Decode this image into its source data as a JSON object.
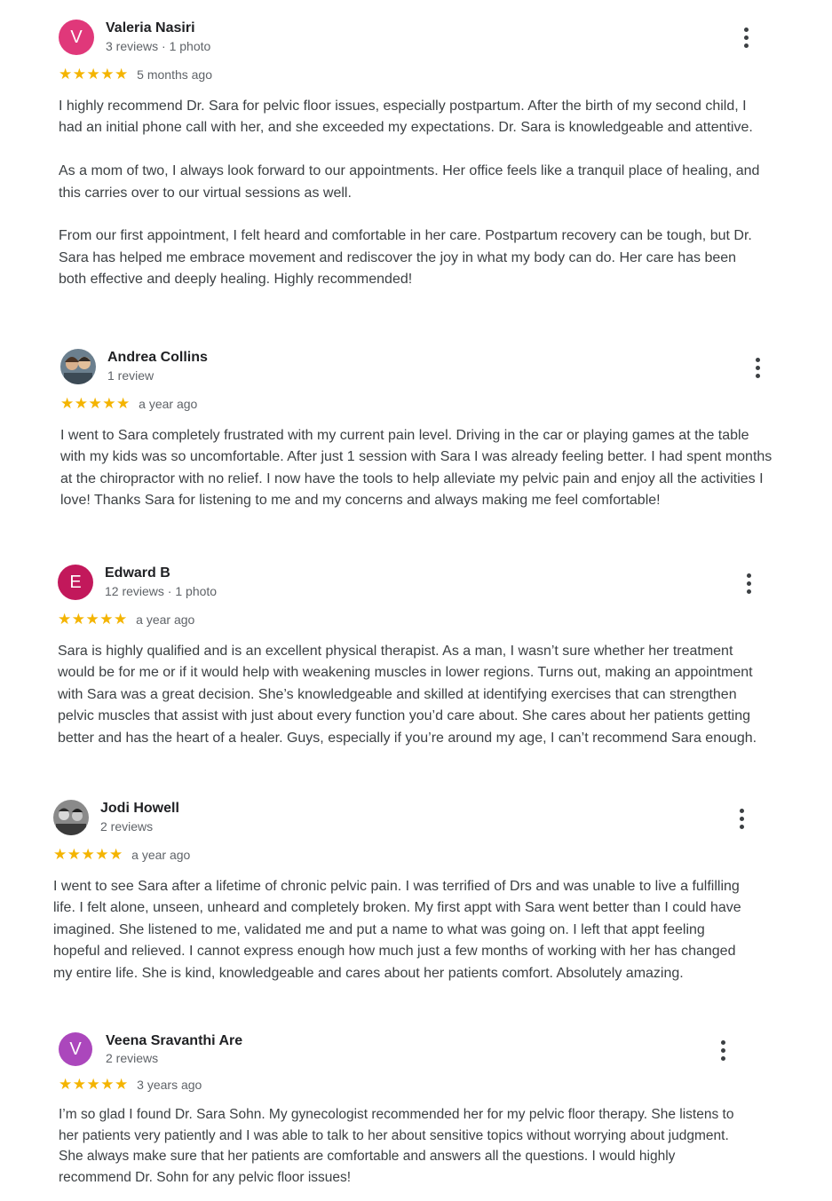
{
  "reviews": [
    {
      "name": "Valeria Nasiri",
      "initial": "V",
      "avatar_color": "#e0387a",
      "meta": "3 reviews · 1 photo",
      "stars": "★★★★★",
      "time": "5 months ago",
      "paragraphs": [
        "I highly recommend Dr. Sara for pelvic floor issues, especially postpartum. After the birth of my second child, I had an initial phone call with her, and she exceeded my expectations. Dr. Sara is knowledgeable and attentive.",
        "As a mom of two, I always look forward to our appointments. Her office feels like a tranquil place of healing, and this carries over to our virtual sessions as well.",
        "From our first appointment, I felt heard and comfortable in her care. Postpartum recovery can be tough, but Dr. Sara has helped me embrace movement and rediscover the joy in what my body can do. Her care has been both effective and deeply healing. Highly recommended!"
      ]
    },
    {
      "name": "Andrea Collins",
      "meta": "1 review",
      "stars": "★★★★★",
      "time": "a year ago",
      "paragraphs": [
        "I went to Sara completely frustrated with my current pain level. Driving in the car or playing games at the table with my kids was so uncomfortable. After just 1 session with Sara I was already feeling better. I had spent months at the chiropractor with no relief. I now have the tools to help alleviate my pelvic pain and enjoy all the activities I love! Thanks Sara for listening to me and my concerns and always making me feel comfortable!"
      ]
    },
    {
      "name": "Edward B",
      "initial": "E",
      "avatar_color": "#c2185b",
      "meta": "12 reviews · 1 photo",
      "stars": "★★★★★",
      "time": "a year ago",
      "paragraphs": [
        "Sara is highly qualified and is an excellent physical therapist. As a man, I wasn’t sure whether her treatment would be for me or if it would help with weakening muscles in lower regions. Turns out, making an appointment with Sara was a great decision. She’s knowledgeable and skilled at identifying exercises that can strengthen pelvic muscles that assist with just about every function you’d care about. She cares about her patients getting better and has the heart of a healer. Guys, especially if you’re around my age, I can’t recommend Sara enough."
      ]
    },
    {
      "name": "Jodi Howell",
      "meta": "2 reviews",
      "stars": "★★★★★",
      "time": "a year ago",
      "paragraphs": [
        "I went to see Sara after a lifetime of chronic pelvic pain. I was terrified of Drs and was unable to live a fulfilling life. I felt alone, unseen, unheard and completely broken. My first appt with Sara went better than I could have imagined. She listened to me, validated me and put a name to what was going on. I left that appt feeling hopeful and relieved. I cannot express enough how much just a few months of working with her has changed my entire life. She is kind, knowledgeable and cares about her patients comfort. Absolutely amazing."
      ]
    },
    {
      "name": "Veena Sravanthi Are",
      "initial": "V",
      "avatar_color": "#ab47bc",
      "meta": "2 reviews",
      "stars": "★★★★★",
      "time": "3 years ago",
      "paragraphs": [
        "I’m so glad I found Dr. Sara Sohn. My gynecologist recommended her for my pelvic floor therapy. She listens to her patients very patiently and I was able to talk to her about sensitive topics without worrying about judgment. She always make sure that her patients are comfortable and answers all the questions. I would highly recommend Dr. Sohn for any pelvic floor issues!"
      ]
    }
  ]
}
